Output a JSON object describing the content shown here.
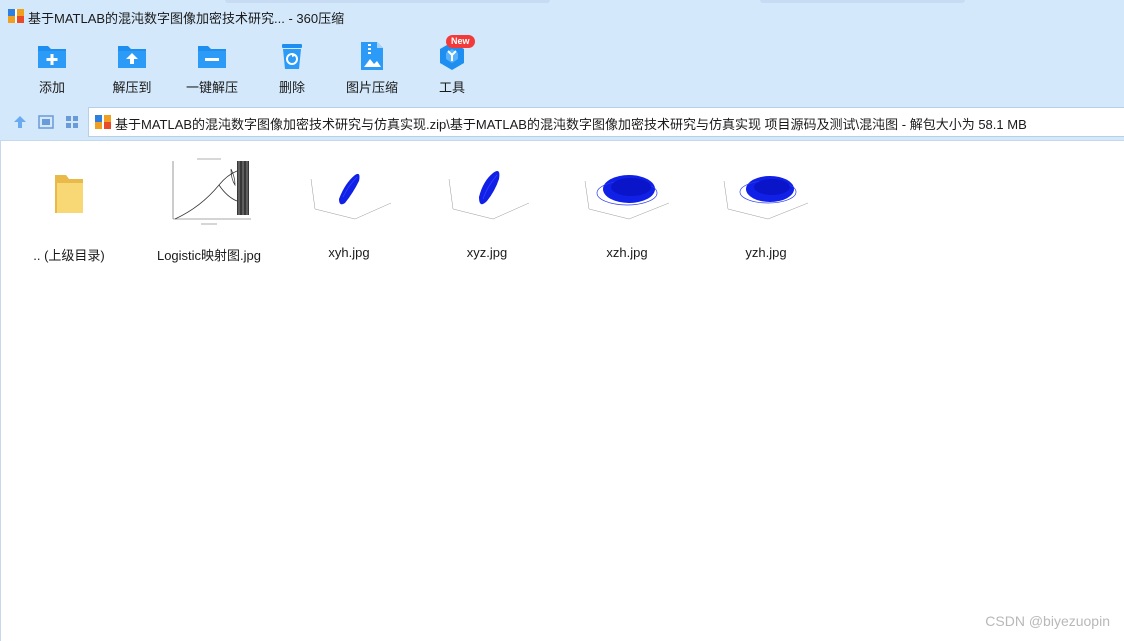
{
  "window": {
    "title": "基于MATLAB的混沌数字图像加密技术研究... - 360压缩"
  },
  "toolbar": {
    "items": [
      {
        "label": "添加",
        "icon": "add-icon"
      },
      {
        "label": "解压到",
        "icon": "extract-to-icon"
      },
      {
        "label": "一键解压",
        "icon": "one-click-extract-icon"
      },
      {
        "label": "删除",
        "icon": "delete-icon"
      },
      {
        "label": "图片压缩",
        "icon": "image-compress-icon"
      },
      {
        "label": "工具",
        "icon": "tools-icon",
        "badge": "New"
      }
    ]
  },
  "address": {
    "path": "基于MATLAB的混沌数字图像加密技术研究与仿真实现.zip\\基于MATLAB的混沌数字图像加密技术研究与仿真实现 项目源码及测试\\混沌图 - 解包大小为 58.1 MB"
  },
  "files": [
    {
      "name": ".. (上级目录)",
      "type": "parent-folder"
    },
    {
      "name": "Logistic映射图.jpg",
      "type": "image"
    },
    {
      "name": "xyh.jpg",
      "type": "image"
    },
    {
      "name": "xyz.jpg",
      "type": "image"
    },
    {
      "name": "xzh.jpg",
      "type": "image"
    },
    {
      "name": "yzh.jpg",
      "type": "image"
    }
  ],
  "watermark": "CSDN @biyezuopin",
  "colors": {
    "chrome": "#d4e8fb",
    "icon_blue": "#1e8ff0",
    "badge": "#f23a3a",
    "plot_blue": "#0a14e6"
  }
}
